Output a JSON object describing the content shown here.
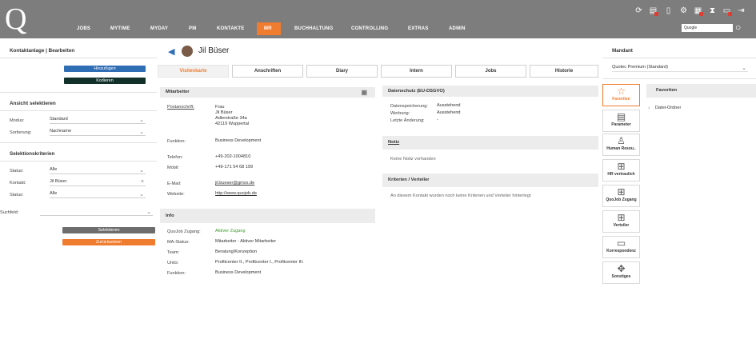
{
  "app": {
    "logo": "Q"
  },
  "nav": [
    "JOBS",
    "MYTIME",
    "MYDAY",
    "PM",
    "KONTAKTE",
    "MR",
    "BUCHHALTUNG",
    "CONTROLLING",
    "EXTRAS",
    "ADMIN"
  ],
  "search": {
    "value": "Quogle"
  },
  "left": {
    "section1": {
      "title": "Kontaktanlage | Bearbeiten",
      "add_button": "Hinzufügen",
      "code_button": "Kodieren"
    },
    "section2": {
      "title": "Ansicht selektieren",
      "rows": [
        {
          "label": "Modus:",
          "value": "Standard"
        },
        {
          "label": "Sortierung:",
          "value": "Nachname"
        }
      ]
    },
    "section3": {
      "title": "Selektionskriterien",
      "rows": [
        {
          "label": "Status:",
          "value": "Alle"
        },
        {
          "label": "Kontakt:",
          "value": "Jil Büser"
        },
        {
          "label": "Status:",
          "value": "Alle"
        }
      ],
      "suchfeld_label": "Suchfeld:",
      "select_button": "Selektieren",
      "reset_button": "Zurücksetzen"
    }
  },
  "contact": {
    "name": "Jil Büser"
  },
  "tabs": [
    "Visitenkarte",
    "Anschriften",
    "Diary",
    "Intern",
    "Jobs",
    "Historie"
  ],
  "mitarbeiter": {
    "title": "Mitarbeiter",
    "postanschrift_label": "Postanschrift:",
    "postanschrift_lines": [
      "Frau",
      "Jil Büser",
      "Adlerstraße 34a",
      "42119 Wuppertal"
    ],
    "funktion_label": "Funktion:",
    "funktion": "Business Development",
    "telefon_label": "Telefon:",
    "telefon": "+49-202-1004810",
    "mobil_label": "Mobil:",
    "mobil": "+49-171 54 68 199",
    "email_label": "E-Mail:",
    "email": "jil.bueser@gmxx.de",
    "website_label": "Website:",
    "website": "http://www.quojob.de"
  },
  "info": {
    "title": "Info",
    "rows": [
      {
        "label": "QuoJob Zugang:",
        "value": "Aktiver Zugang"
      },
      {
        "label": "MA-Status:",
        "value": "Mitarbeiter - Aktiver Mitarbeiter"
      },
      {
        "label": "Team:",
        "value": "Beratung/Konzeption"
      },
      {
        "label": "Units:",
        "value": "Profitcenter II., Profitcenter I., Profitcenter III."
      },
      {
        "label": "Funktion:",
        "value": "Business Development"
      }
    ]
  },
  "datenschutz": {
    "title": "Datenschutz (EU-DSGVO)",
    "rows": [
      {
        "label": "Datenspeicherung:",
        "value": "Ausstehend"
      },
      {
        "label": "Werbung:",
        "value": "Ausstehend"
      },
      {
        "label": "Letzte Änderung:",
        "value": "-"
      }
    ]
  },
  "notiz": {
    "title": "Notiz",
    "text": "Keine Notiz vorhanden"
  },
  "kriterien": {
    "title": "Kriterien / Verteiler",
    "text": "An diesem Kontakt wurden noch keine Kriterien und Verteiler hinterlegt"
  },
  "mandant": {
    "title": "Mandant",
    "value": "Quotec Premium (Standard)"
  },
  "favoriten": {
    "title": "Favoriten",
    "item": "Datei-Ordner"
  },
  "side_buttons": [
    {
      "label": "Favoriten",
      "icon": "star-icon"
    },
    {
      "label": "Parameter",
      "icon": "document-icon"
    },
    {
      "label": "Human Resou..",
      "icon": "person-icon"
    },
    {
      "label": "HR vertraulich",
      "icon": "org-chart-icon"
    },
    {
      "label": "QuoJob Zugang",
      "icon": "org-chart-icon"
    },
    {
      "label": "Verteiler",
      "icon": "org-chart-icon"
    },
    {
      "label": "Korrespondenz",
      "icon": "chat-icon"
    },
    {
      "label": "Sonstiges",
      "icon": "move-arrows-icon"
    }
  ],
  "colors": {
    "accent": "#f07c2f",
    "topbar": "#7d7d7d",
    "button_blue": "#2f6db5",
    "button_dark": "#12302a",
    "button_grey": "#6d6d6d",
    "green": "#3d9a2c"
  }
}
